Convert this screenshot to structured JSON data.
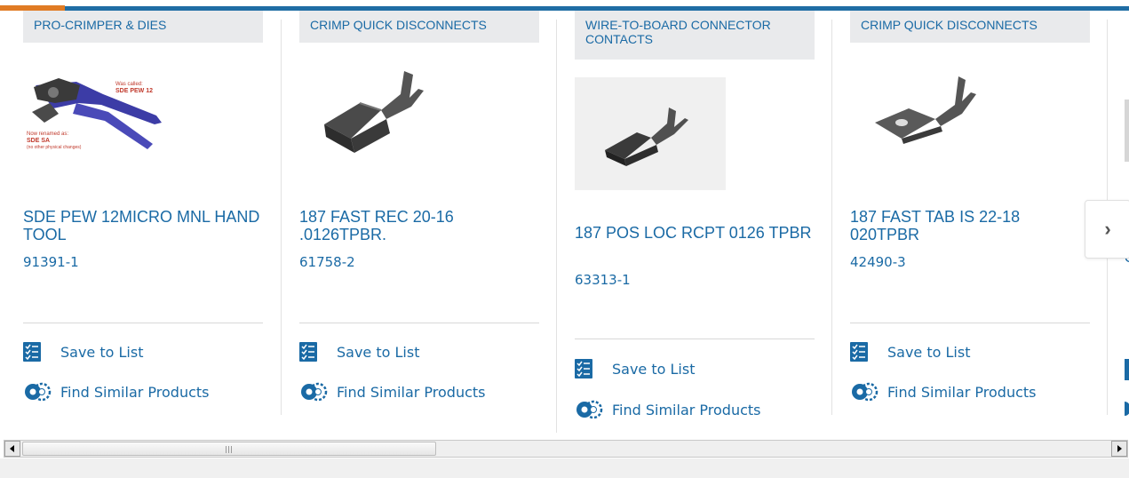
{
  "carousel": {
    "cards": [
      {
        "category": "PRO-CRIMPER & DIES",
        "title": "SDE PEW 12MICRO MNL HAND TOOL",
        "part_number": "91391-1",
        "image_caption_top": "Was called:",
        "image_caption_top2": "SDE PEW 12",
        "image_caption_bottom": "Now renamed as:",
        "image_caption_bottom2": "SDE SA",
        "image_caption_bottom3": "(no other physical changes)"
      },
      {
        "category": "CRIMP QUICK DISCONNECTS",
        "title": "187 FAST REC 20-16 .0126TPBR.",
        "part_number": "61758-2"
      },
      {
        "category": "WIRE-TO-BOARD CONNECTOR CONTACTS",
        "title": "187 POS LOC RCPT 0126 TPBR",
        "part_number": "63313-1"
      },
      {
        "category": "CRIMP QUICK DISCONNECTS",
        "title": "187 FAST TAB IS 22-18 020TPBR",
        "part_number": "42490-3"
      }
    ],
    "save_label": "Save to List",
    "similar_label": "Find Similar Products",
    "next_glyph": "›",
    "peek_glyph": "C"
  },
  "colors": {
    "accent_blue": "#1a6aa5",
    "bar_orange": "#e07b24",
    "category_bg": "#e9eaec"
  },
  "icons": [
    "list-check-icon",
    "gear-similar-icon",
    "chevron-right-icon"
  ]
}
